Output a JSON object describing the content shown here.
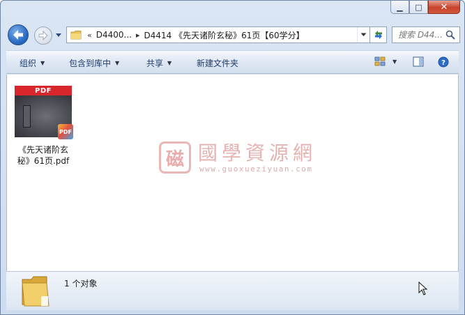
{
  "window": {
    "caption_buttons": {
      "minimize_glyph": "▁",
      "maximize_glyph": "□",
      "close_glyph": "✕"
    }
  },
  "navigation": {
    "back_icon": "back-arrow-icon",
    "forward_icon": "forward-arrow-icon",
    "breadcrumb": {
      "overflow": "«",
      "segments": [
        "D4400...",
        "D4414 《先天诸阶玄秘》61页【60学分】"
      ],
      "separator": "▸"
    },
    "search": {
      "placeholder": "搜索 D44..."
    }
  },
  "toolbar": {
    "organize": "组织",
    "include_in_library": "包含到库中",
    "share": "共享",
    "new_folder": "新建文件夹"
  },
  "content": {
    "files": [
      {
        "name": "《先天诸阶玄秘》61页.pdf",
        "badge": "PDF",
        "thumb_label": "PDF",
        "icon": "pdf-file-icon"
      }
    ],
    "watermark": {
      "seal_char": "磁",
      "title": "國學資源網",
      "url": "www.guoxueziyuan.com"
    }
  },
  "status_bar": {
    "count_text": "1 个对象"
  },
  "colors": {
    "pdf_red": "#d8262c",
    "accent_blue": "#2c6cc5",
    "watermark": "#e3aaaa"
  }
}
